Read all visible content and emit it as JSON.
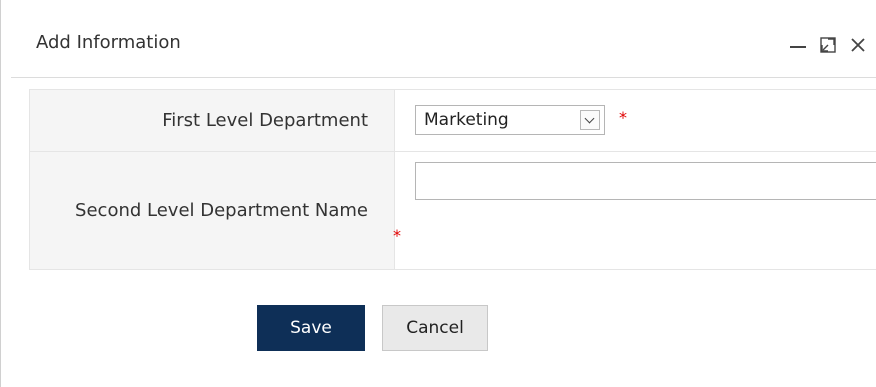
{
  "dialog": {
    "title": "Add Information",
    "controls": {
      "minimize_icon": "minimize-icon",
      "maximize_icon": "maximize-icon",
      "close_icon": "close-icon"
    },
    "form": {
      "first_level": {
        "label": "First Level Department",
        "selected": "Marketing",
        "required_mark": "*"
      },
      "second_level": {
        "label": "Second Level Department Name",
        "value": "",
        "required_mark": "*"
      }
    },
    "buttons": {
      "save": "Save",
      "cancel": "Cancel"
    }
  }
}
